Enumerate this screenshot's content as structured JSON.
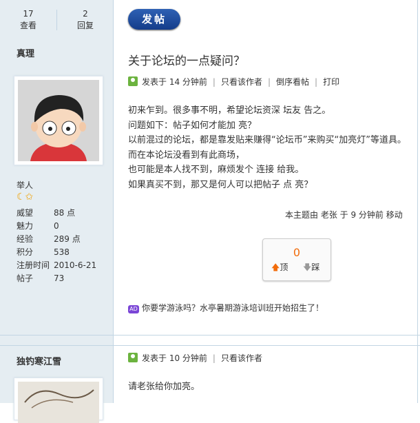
{
  "stats": {
    "views_count": "17",
    "views_label": "查看",
    "replies_count": "2",
    "replies_label": "回复"
  },
  "toolbar": {
    "post_button": "发帖"
  },
  "post1": {
    "author": "真理",
    "rank": "举人",
    "props": [
      {
        "k": "威望",
        "v": "88 点"
      },
      {
        "k": "魅力",
        "v": "0"
      },
      {
        "k": "经验",
        "v": "289 点"
      },
      {
        "k": "积分",
        "v": "538"
      },
      {
        "k": "注册时间",
        "v": "2010-6-21"
      },
      {
        "k": "帖子",
        "v": "73"
      }
    ],
    "title": "关于论坛的一点疑问？",
    "meta": {
      "posted": "发表于 14 分钟前",
      "only_author": "只看该作者",
      "reverse": "倒序看帖",
      "print": "打印"
    },
    "body": [
      "初来乍到。很多事不明，希望论坛资深 坛友 告之。",
      "问题如下：帖子如何才能加 亮？",
      "以前混过的论坛，都是靠发贴来赚得“论坛币”来购买“加亮灯”等道具。",
      "而在本论坛没看到有此商场，",
      "也可能是本人找不到，麻烦发个 连接 给我。",
      "如果真买不到，那又是何人可以把帖子 点 亮？"
    ],
    "moved_note": "本主题由 老张 于 9 分钟前 移动",
    "vote": {
      "count": "0",
      "up": "顶",
      "down": "踩"
    },
    "ad": "你要学游泳吗？水亭暑期游泳培训班开始招生了！"
  },
  "post2": {
    "author": "独钓寒江雪",
    "meta": {
      "posted": "发表于 10 分钟前",
      "only_author": "只看该作者"
    },
    "body": "请老张给你加亮。"
  }
}
